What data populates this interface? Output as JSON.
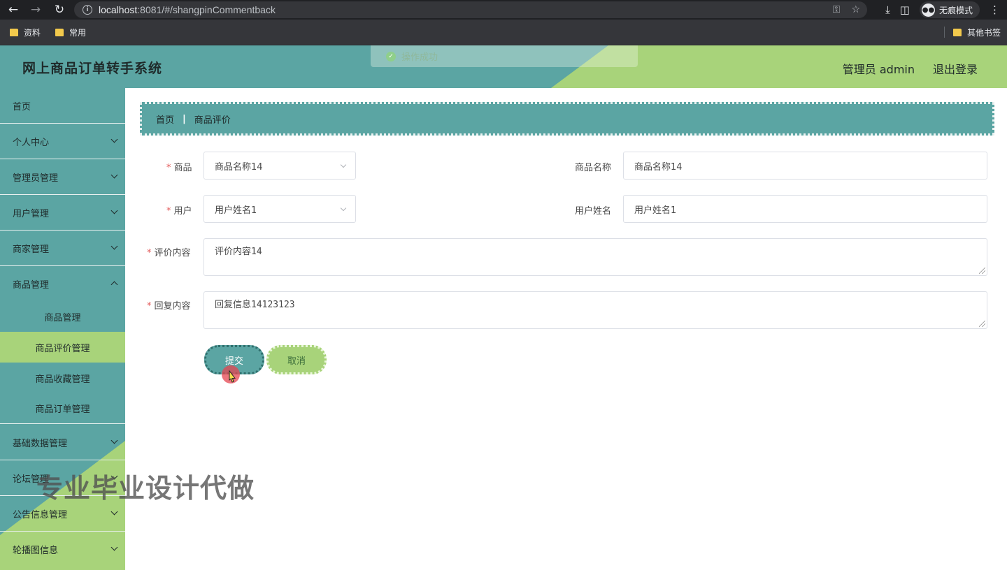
{
  "browser": {
    "url_host": "localhost",
    "url_rest": ":8081/#/shangpinCommentback",
    "incognito_label": "无痕模式",
    "bookmarks": [
      "资料",
      "常用"
    ],
    "other_bookmarks": "其他书签"
  },
  "header": {
    "title": "网上商品订单转手系统",
    "toast": "操作成功",
    "user": "管理员 admin",
    "logout": "退出登录",
    "colors": {
      "teal": "#5ba5a3",
      "green": "#a8d37a"
    }
  },
  "sidebar": {
    "items": [
      {
        "label": "首页",
        "chevron": false
      },
      {
        "label": "个人中心",
        "chevron": true
      },
      {
        "label": "管理员管理",
        "chevron": true
      },
      {
        "label": "用户管理",
        "chevron": true
      },
      {
        "label": "商家管理",
        "chevron": true
      },
      {
        "label": "商品管理",
        "chevron": true
      }
    ],
    "subitems": [
      "商品管理",
      "商品评价管理",
      "商品收藏管理",
      "商品订单管理"
    ],
    "active_subitem": "商品评价管理",
    "bottom_items": [
      "基础数据管理",
      "论坛管理",
      "公告信息管理",
      "轮播图信息"
    ]
  },
  "breadcrumb": {
    "home": "首页",
    "current": "商品评价"
  },
  "form": {
    "product_label": "商品",
    "product_value": "商品名称14",
    "product_name_label": "商品名称",
    "product_name_value": "商品名称14",
    "user_label": "用户",
    "user_value": "用户姓名1",
    "user_name_label": "用户姓名",
    "user_name_value": "用户姓名1",
    "comment_label": "评价内容",
    "comment_value": "评价内容14",
    "reply_label": "回复内容",
    "reply_value": "回复信息14123123",
    "submit": "提交",
    "cancel": "取消"
  },
  "watermark": "专业毕业设计代做"
}
